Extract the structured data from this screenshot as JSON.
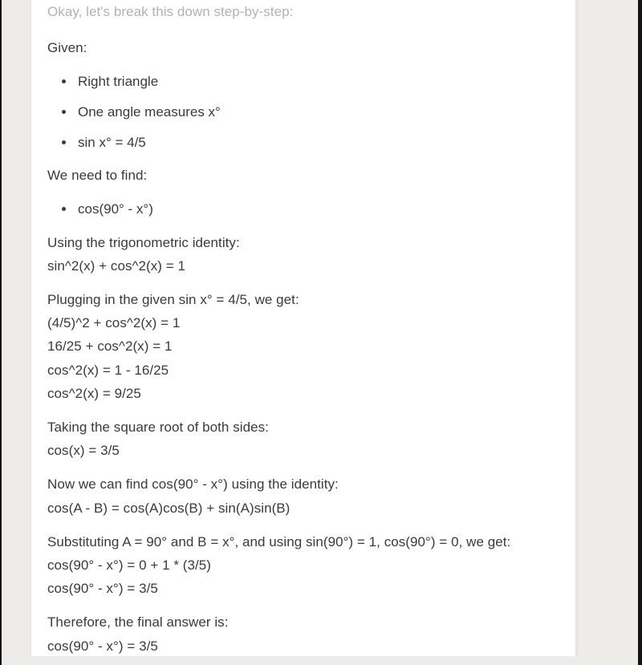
{
  "theme": {
    "frame_color": "#111111",
    "gutter_color": "#edece9",
    "panel_color": "#ffffff",
    "text_color": "#3a3a3a",
    "faded_text_color": "#b4b2b0"
  },
  "message": {
    "intro_faded": "Okay, let's break this down step-by-step:",
    "given_heading": "Given:",
    "given_items": [
      "Right triangle",
      "One angle measures x°",
      "sin x° = 4/5"
    ],
    "find_heading": "We need to find:",
    "find_items": [
      "cos(90° - x°)"
    ],
    "identity_block": {
      "heading": "Using the trigonometric identity:",
      "lines": [
        "sin^2(x) + cos^2(x) = 1"
      ]
    },
    "plugging_block": {
      "heading": "Plugging in the given sin x° = 4/5, we get:",
      "lines": [
        "(4/5)^2 + cos^2(x) = 1",
        "16/25 + cos^2(x) = 1",
        "cos^2(x) = 1 - 16/25",
        "cos^2(x) = 9/25"
      ]
    },
    "sqrt_block": {
      "heading": "Taking the square root of both sides:",
      "lines": [
        "cos(x) = 3/5"
      ]
    },
    "now_block": {
      "heading": "Now we can find cos(90° - x°) using the identity:",
      "lines": [
        "cos(A - B) = cos(A)cos(B) + sin(A)sin(B)"
      ]
    },
    "substitute_block": {
      "heading": "Substituting A = 90° and B = x°, and using sin(90°) = 1, cos(90°) = 0, we get:",
      "lines": [
        "cos(90° - x°) = 0 + 1 * (3/5)",
        "cos(90° - x°) = 3/5"
      ]
    },
    "final_block": {
      "heading": "Therefore, the final answer is:",
      "lines": [
        "cos(90° - x°) = 3/5"
      ]
    }
  }
}
